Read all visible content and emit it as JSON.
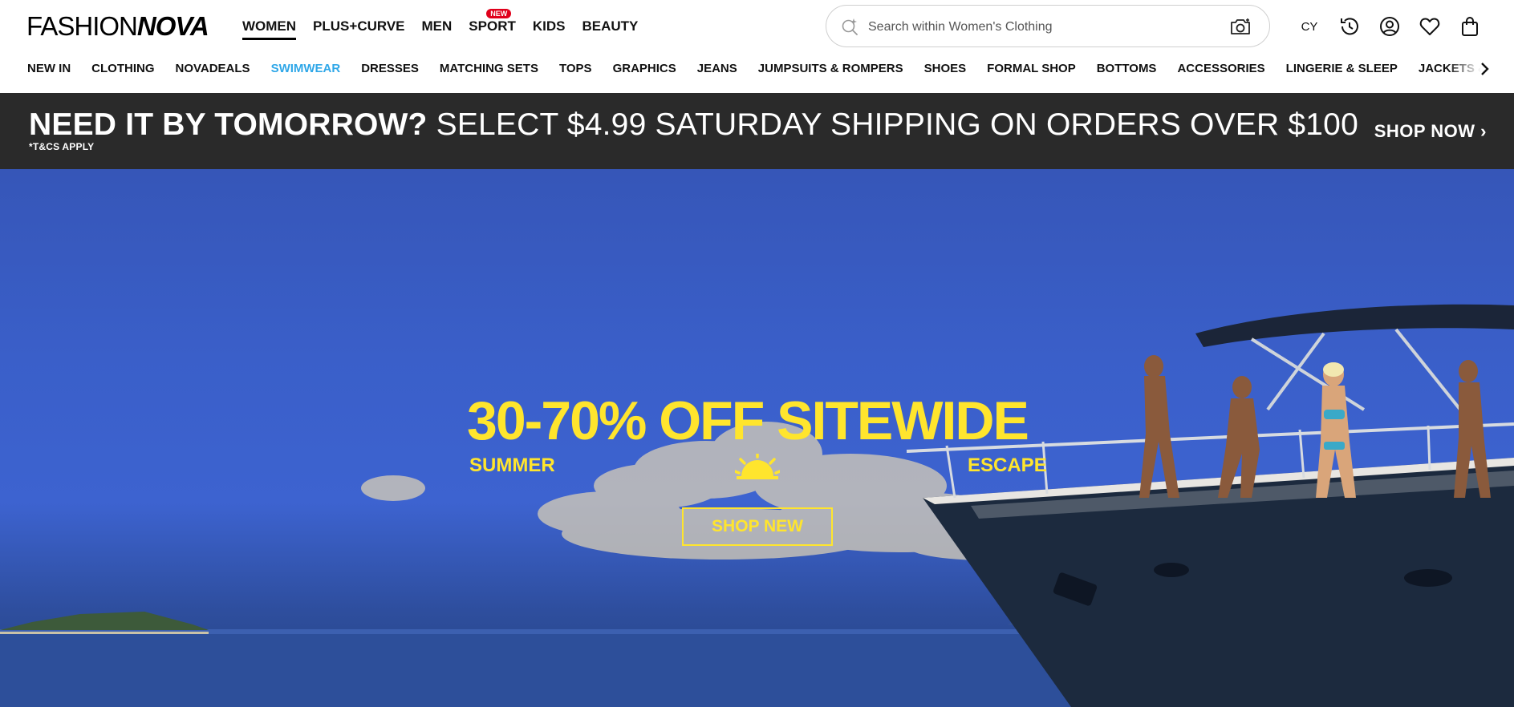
{
  "header": {
    "logo": {
      "part1": "FASHION",
      "part2": "NOVA"
    },
    "top_nav": [
      {
        "label": "WOMEN",
        "active": true
      },
      {
        "label": "PLUS+CURVE"
      },
      {
        "label": "MEN"
      },
      {
        "label": "SPORT",
        "badge": "NEW"
      },
      {
        "label": "KIDS"
      },
      {
        "label": "BEAUTY"
      }
    ],
    "search": {
      "placeholder": "Search within Women's Clothing",
      "icon": "search-sparkle-icon",
      "camera_icon": "camera-icon"
    },
    "utilities": {
      "country": "CY",
      "icons": [
        "history-icon",
        "account-icon",
        "heart-icon",
        "bag-icon"
      ]
    },
    "categories": [
      "NEW IN",
      "CLOTHING",
      "NOVADEALS",
      "SWIMWEAR",
      "DRESSES",
      "MATCHING SETS",
      "TOPS",
      "GRAPHICS",
      "JEANS",
      "JUMPSUITS & ROMPERS",
      "SHOES",
      "FORMAL SHOP",
      "BOTTOMS",
      "ACCESSORIES",
      "LINGERIE & SLEEP",
      "JACKETS & COATS"
    ],
    "highlight_category": "SWIMWEAR"
  },
  "promo": {
    "headline_bold": "NEED IT BY TOMORROW?",
    "headline_rest": " SELECT $4.99 SATURDAY SHIPPING ON ORDERS OVER $100",
    "terms": "*T&CS APPLY",
    "cta": "SHOP NOW ›",
    "background": "#2a2a2a"
  },
  "hero": {
    "title": "30-70% OFF SITEWIDE",
    "sub_left": "SUMMER",
    "sub_right": "ESCAPE",
    "cta": "SHOP NEW",
    "accent_color": "#ffe52d"
  }
}
